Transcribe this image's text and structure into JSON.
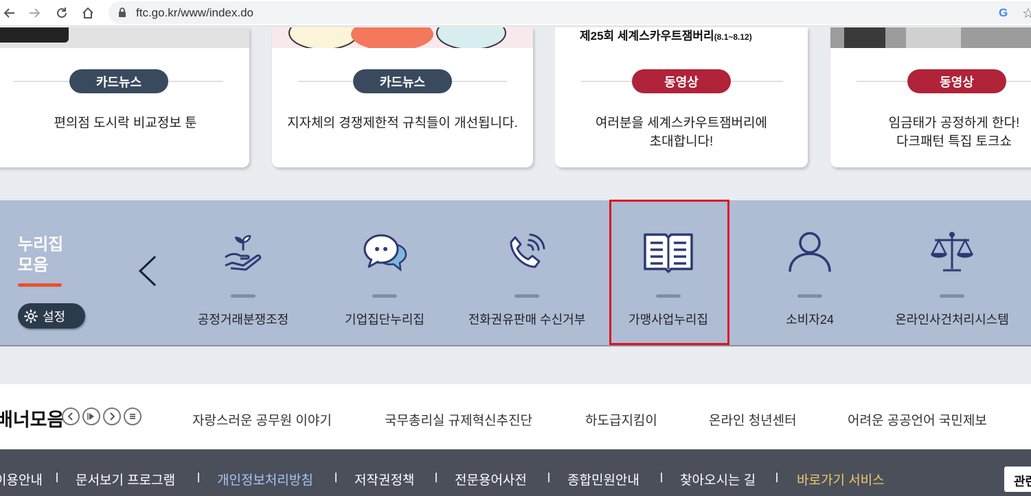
{
  "browser": {
    "url": "ftc.go.kr/www/index.do",
    "google_letter": "G",
    "star": "☆"
  },
  "cards": [
    {
      "badge": "카드뉴스",
      "text": "편의점 도시락 비교정보 툰"
    },
    {
      "badge": "카드뉴스",
      "text": "지자체의 경쟁제한적 규칙들이 개선됩니다."
    },
    {
      "badge": "동영상",
      "text": "여러분을 세계스카우트잼버리에\n초대합니다!",
      "image_caption": "제25회 세계스카우트잼버리",
      "image_caption_small": "(8.1~8.12)"
    },
    {
      "badge": "동영상",
      "text": "임금태가 공정하게 한다!\n다크패턴 특집 토크쇼"
    }
  ],
  "colors": {
    "badge_dark": "#3a4a5e",
    "badge_red": "#b02338",
    "nuri_band": "#aebcd4",
    "icon_navy": "#2c3a73",
    "highlight": "#e0111b",
    "footer_bg": "#4a4f5a"
  },
  "nurizip": {
    "title_line1": "누리집",
    "title_line2": "모음",
    "settings_label": "설정",
    "items": [
      {
        "label": "공정거래분쟁조정",
        "icon": "plant-hand-icon"
      },
      {
        "label": "기업집단누리집",
        "icon": "chat-bubbles-icon"
      },
      {
        "label": "전화권유판매 수신거부",
        "icon": "phone-call-icon"
      },
      {
        "label": "가맹사업누리집",
        "icon": "open-book-icon"
      },
      {
        "label": "소비자24",
        "icon": "person-icon"
      },
      {
        "label": "온라인사건처리시스템",
        "icon": "scales-icon"
      }
    ]
  },
  "banner": {
    "title": "배너모음",
    "links": [
      "자랑스러운 공무원 이야기",
      "국무총리실 규제혁신추진단",
      "하도급지킴이",
      "온라인 청년센터",
      "어려운 공공언어 국민제보"
    ]
  },
  "footer": {
    "items": [
      "이용안내",
      "문서보기 프로그램",
      "개인정보처리방침",
      "저작권정책",
      "전문용어사전",
      "종합민원안내",
      "찾아오시는 길",
      "바로가기 서비스"
    ],
    "related": "관련"
  }
}
